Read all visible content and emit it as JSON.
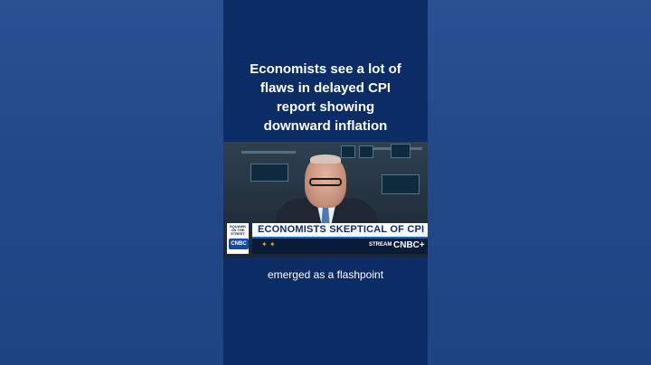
{
  "headline": {
    "lines": [
      "Economists see a lot of",
      "flaws in delayed CPI",
      "report showing",
      "downward inflation"
    ]
  },
  "video": {
    "show_badge": "SQUAWK ON THE STREET",
    "channel_logo": "CNBC",
    "banner_text": "ECONOMISTS SKEPTICAL OF CPI DATA",
    "stream_label": "STREAM",
    "stream_logo": "CNBC+"
  },
  "caption": "emerged as a flashpoint",
  "colors": {
    "background": "#23488a",
    "phone_panel": "#0c2c66",
    "banner_text": "#0b2c6b",
    "accent": "#f0a21b"
  }
}
